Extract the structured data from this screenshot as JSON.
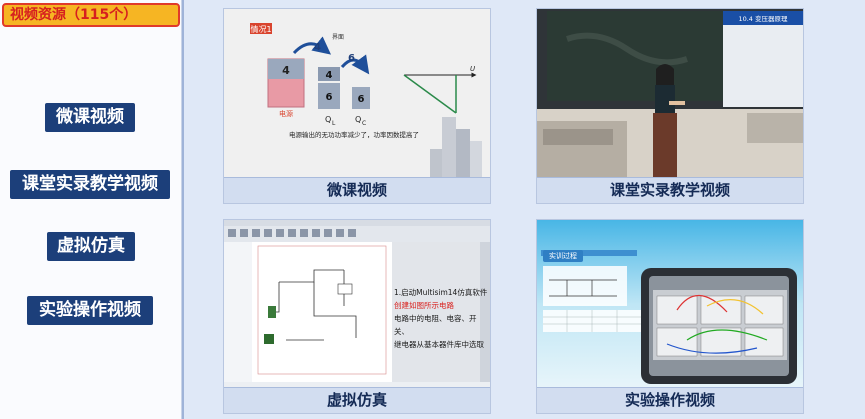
{
  "header": {
    "title": "视频资源（115个）"
  },
  "sidebar": {
    "items": [
      {
        "label": "微课视频"
      },
      {
        "label": "课堂实录教学视频"
      },
      {
        "label": "虚拟仿真"
      },
      {
        "label": "实验操作视频"
      }
    ]
  },
  "cards": [
    {
      "caption": "微课视频",
      "thumb": {
        "tag": "情况1",
        "top_label": "界面",
        "source_label": "电源",
        "block_values": [
          "4",
          "4",
          "6",
          "6",
          "6"
        ],
        "q_labels": [
          "Q",
          "Q"
        ],
        "q_subs": [
          "L",
          "C"
        ],
        "axis_label": "U",
        "text": "电源输出的无功功率减少了，功率因数提高了"
      }
    },
    {
      "caption": "课堂实录教学视频",
      "thumb": {
        "screen_text": "10.4  变压器原理"
      }
    },
    {
      "caption": "虚拟仿真",
      "thumb": {
        "lines": [
          "1.启动Multisim14仿真软件",
          "创建如图所示电路",
          "电路中的电阻、电容、开关、",
          "继电器从基本器件库中选取"
        ]
      }
    },
    {
      "caption": "实验操作视频",
      "thumb": {
        "tag": "实训过程"
      }
    }
  ],
  "colors": {
    "accent": "#1c3f7a",
    "badge_bg": "#f6b523",
    "badge_border": "#e03a2a"
  }
}
